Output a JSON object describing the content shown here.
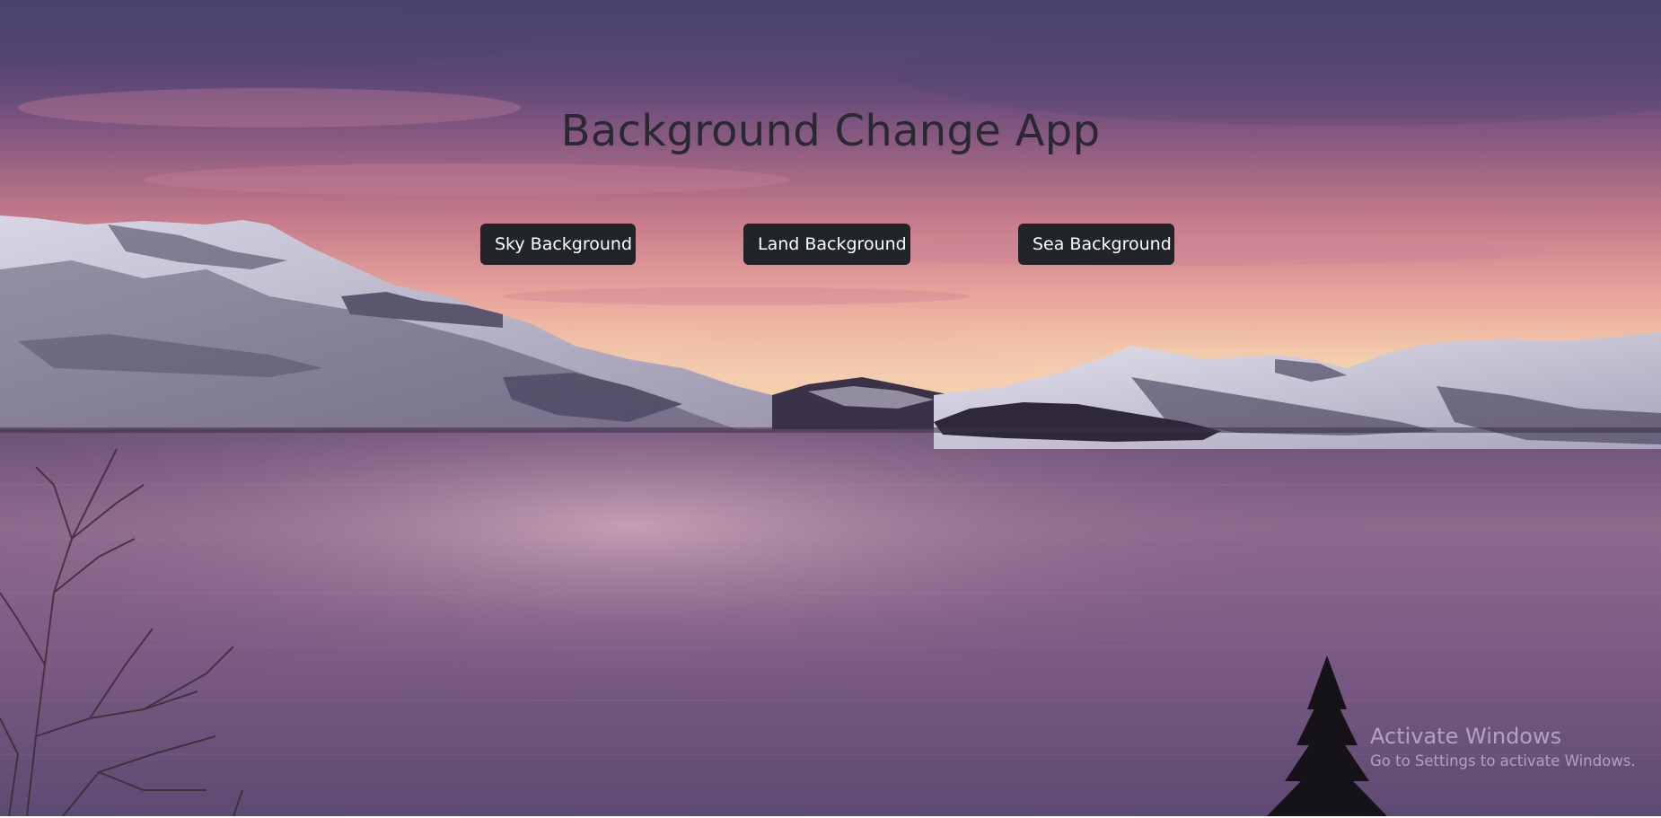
{
  "app": {
    "title": "Background Change App"
  },
  "buttons": {
    "sky": "Sky Background",
    "land": "Land Background",
    "sea": "Sea Background"
  },
  "background": {
    "current": "sky",
    "sky_top": "#4b4570",
    "sky_glow": "#f8e6b8",
    "mountain_snow": "#e6e6f0",
    "water": "#7e5c82"
  },
  "button_style": {
    "background": "#212529",
    "text": "#ffffff"
  },
  "watermark": {
    "title": "Activate Windows",
    "subtitle": "Go to Settings to activate Windows."
  }
}
